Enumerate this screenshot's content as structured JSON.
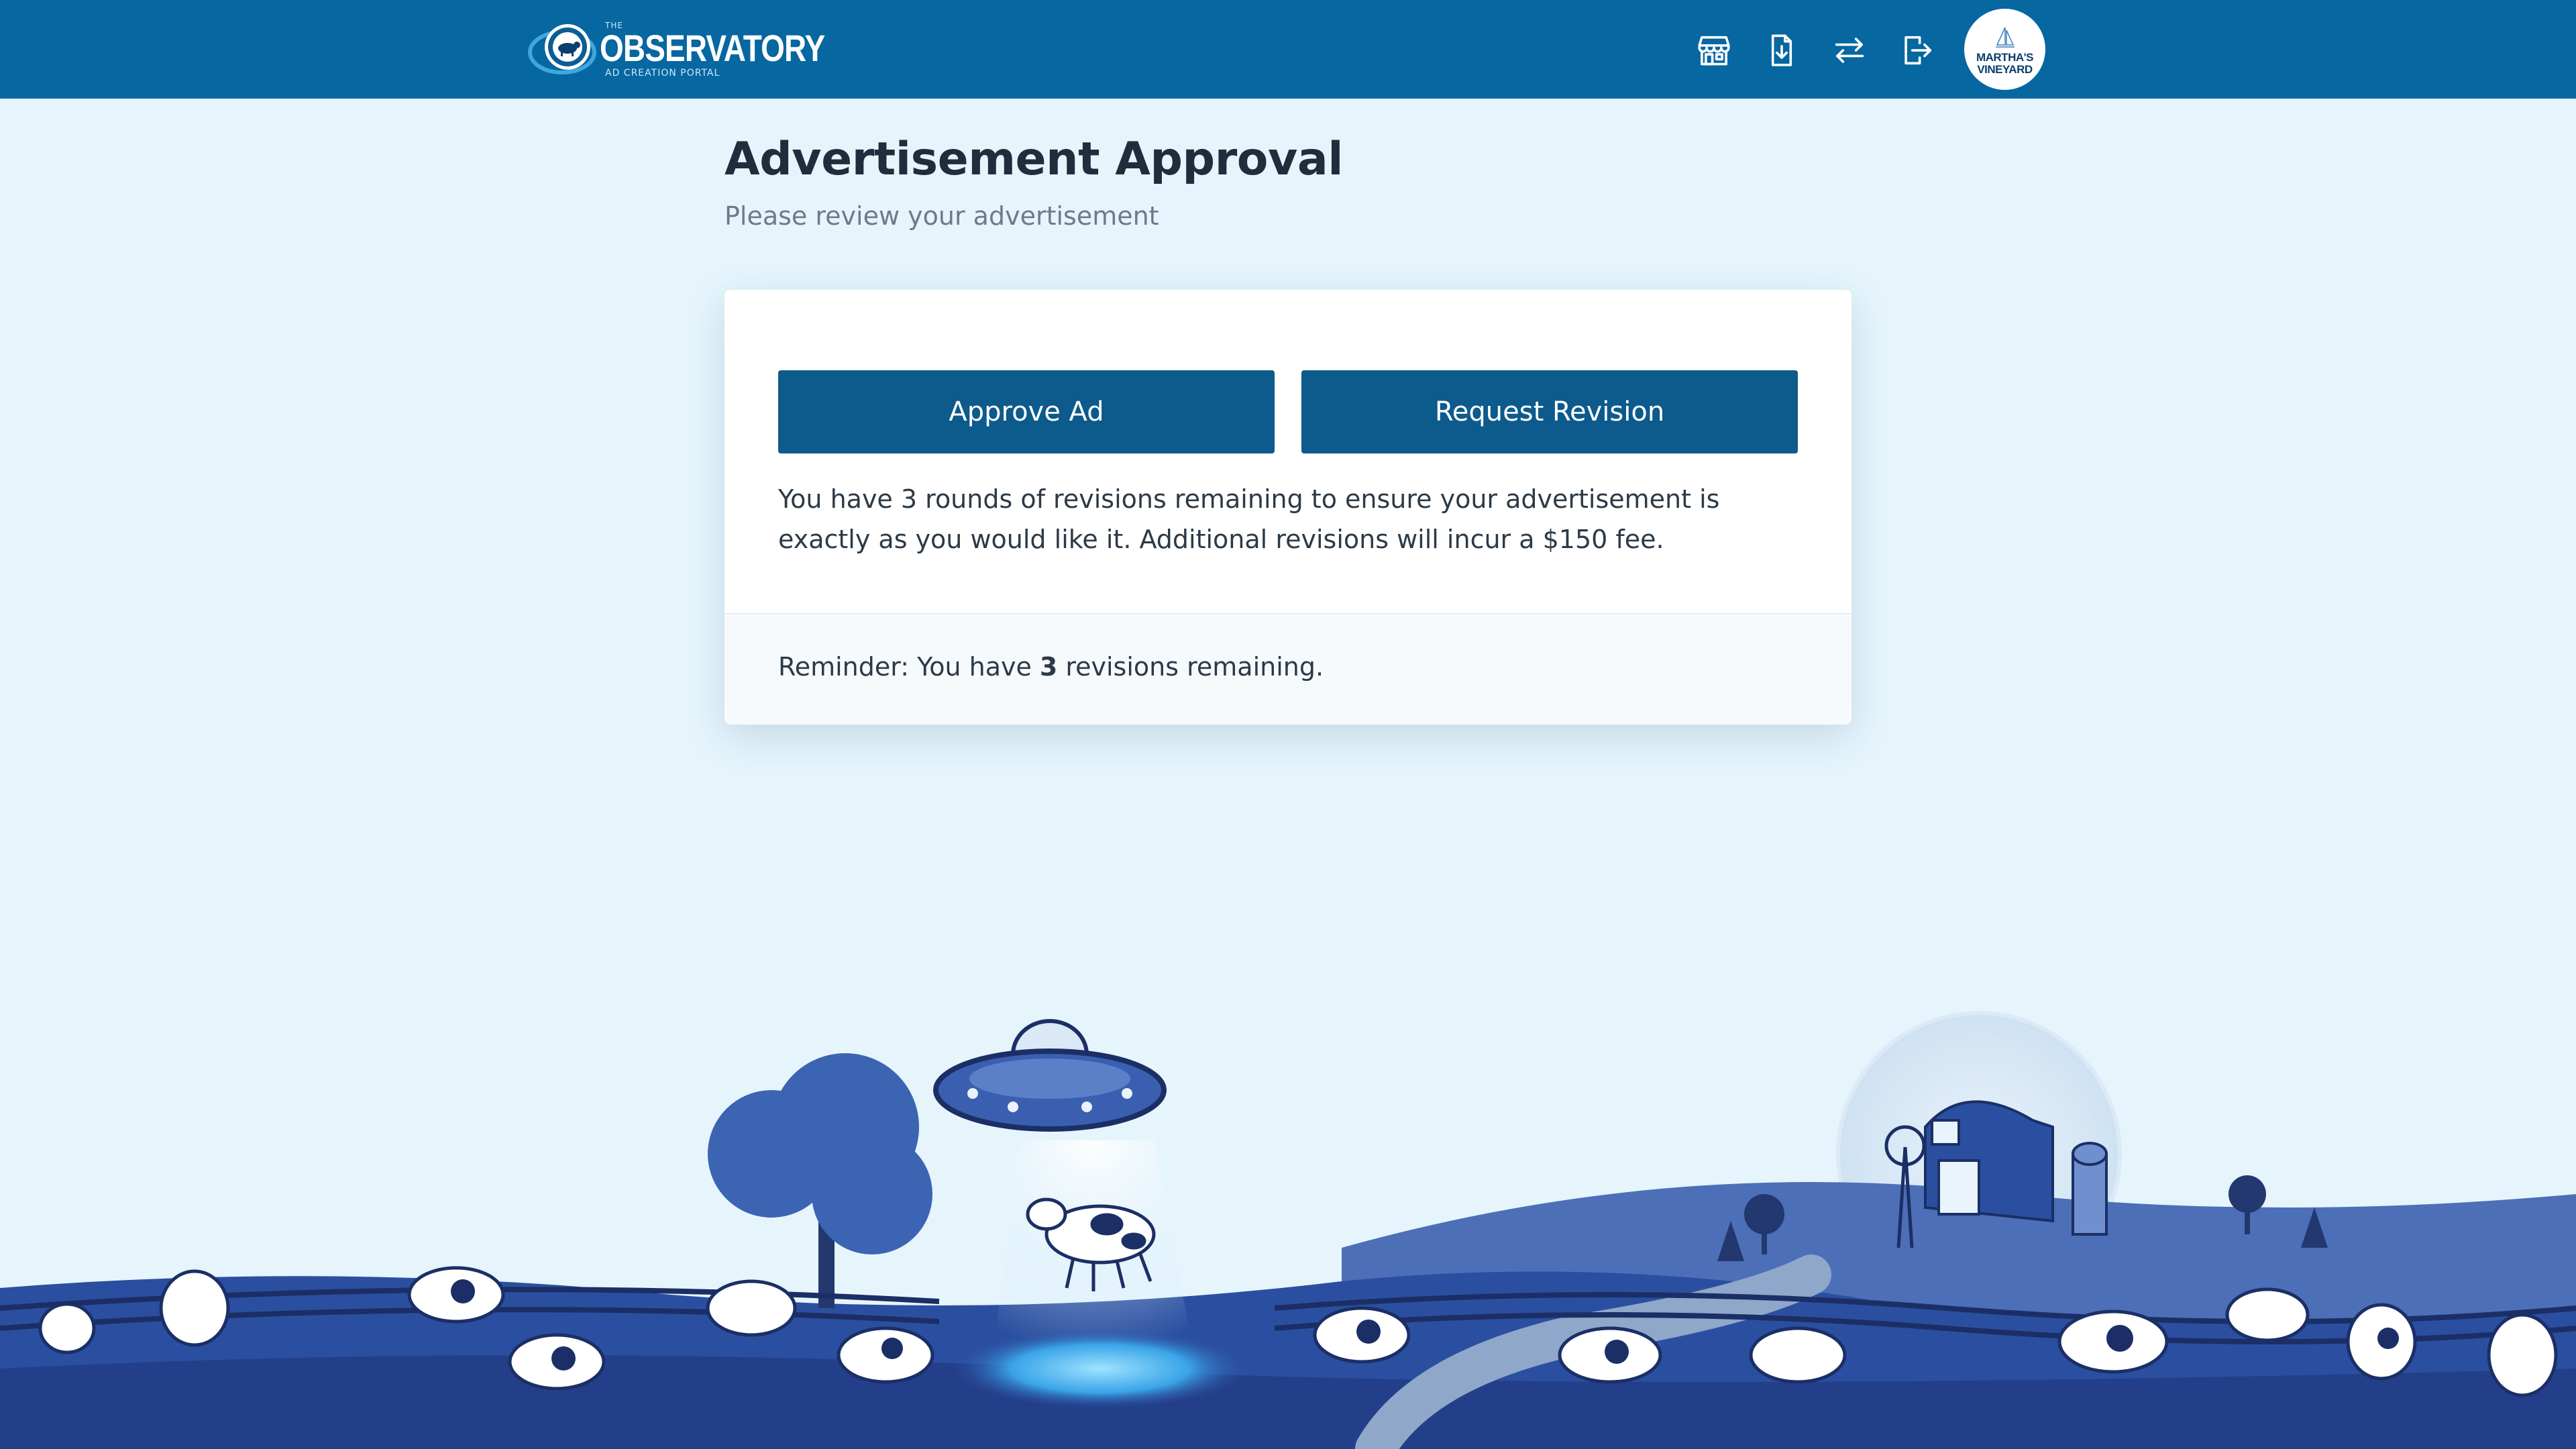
{
  "header": {
    "logo": {
      "prefix": "THE",
      "title": "OBSERVATORY",
      "subtitle": "AD CREATION PORTAL"
    },
    "icons": [
      {
        "name": "storefront-icon"
      },
      {
        "name": "download-file-icon"
      },
      {
        "name": "swap-arrows-icon"
      },
      {
        "name": "logout-icon"
      }
    ],
    "avatar": {
      "line1": "MARTHA'S",
      "line2": "VINEYARD"
    }
  },
  "page": {
    "title": "Advertisement Approval",
    "subtitle": "Please review your advertisement"
  },
  "card": {
    "approve_label": "Approve Ad",
    "revision_label": "Request Revision",
    "message": "You have 3 rounds of revisions remaining to ensure your advertisement is exactly as you would like it. Additional revisions will incur a $150 fee.",
    "reminder_prefix": "Reminder: You have",
    "reminder_count": "3",
    "reminder_suffix": "revisions remaining."
  },
  "colors": {
    "header_bg": "#0667a1",
    "page_bg": "#e6f5fc",
    "button_bg": "#0d5a8c",
    "scenery_blue": "#2b4fa0"
  }
}
